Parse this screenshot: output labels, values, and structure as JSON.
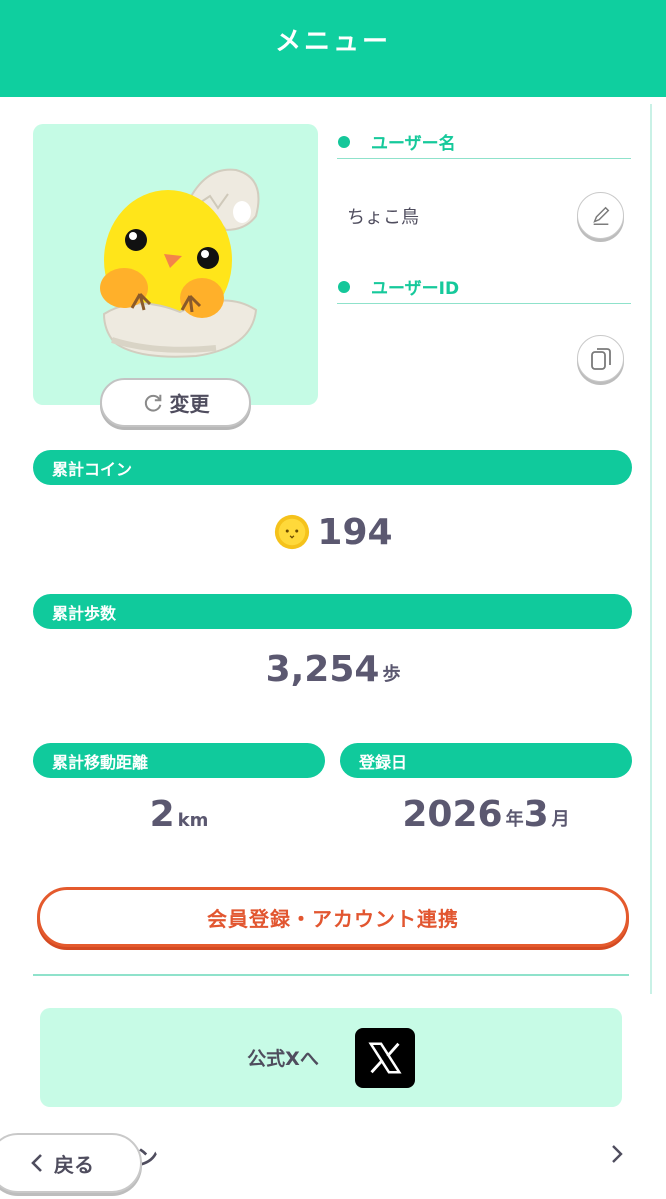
{
  "header": {
    "title": "メニュー"
  },
  "avatar": {
    "change_label": "変更"
  },
  "profile": {
    "username_label": "ユーザー名",
    "username_value": "ちょこ鳥",
    "userid_label": "ユーザーID",
    "userid_value": ""
  },
  "stats": {
    "coins": {
      "label": "累計コイン",
      "value": "194"
    },
    "steps": {
      "label": "累計歩数",
      "value": "3,254",
      "unit": "歩"
    },
    "distance": {
      "label": "累計移動距離",
      "value": "2",
      "unit": "km"
    },
    "registered": {
      "label": "登録日",
      "year": "2026",
      "year_unit": "年",
      "month": "3",
      "month_unit": "月"
    }
  },
  "register_button": {
    "label": "会員登録・アカウント連携"
  },
  "official_x": {
    "label": "公式Xへ"
  },
  "next_row": {
    "partial_label": "ン"
  },
  "back_button": {
    "label": "戻る"
  },
  "colors": {
    "accent": "#0fcf9f",
    "mint_bg": "#c5fbe5",
    "cta": "#e45a2d",
    "text": "#4f4d5e"
  },
  "icons": [
    "refresh-icon",
    "pencil-icon",
    "copy-icon",
    "coin-icon",
    "x-logo-icon",
    "chevron-left-icon",
    "chevron-right-icon"
  ]
}
